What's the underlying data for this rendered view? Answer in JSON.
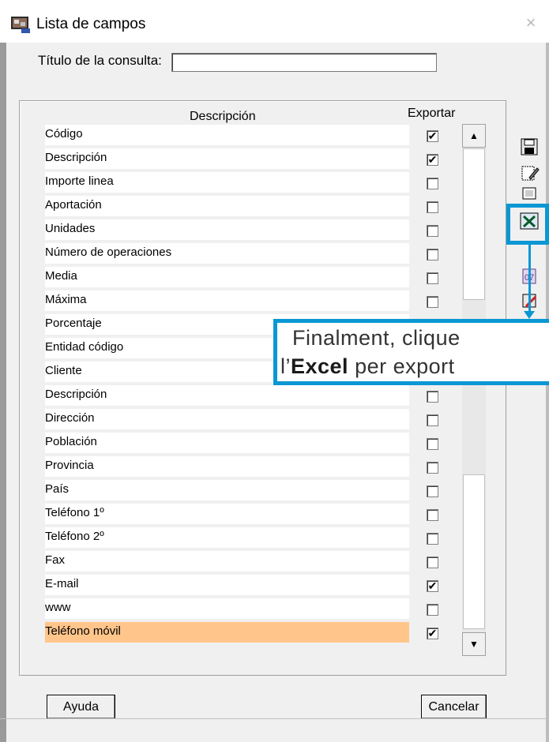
{
  "window": {
    "title": "Lista de campos",
    "close_glyph": "×",
    "accent_color": "#0a97d4",
    "selected_row_color": "#ffc58a"
  },
  "query": {
    "label": "Título de la consulta:",
    "value": ""
  },
  "table": {
    "col_description": "Descripción",
    "col_export": "Exportar",
    "rows": [
      {
        "label": "Código",
        "export": true
      },
      {
        "label": "Descripción",
        "export": true
      },
      {
        "label": "Importe linea",
        "export": false
      },
      {
        "label": "Aportación",
        "export": false
      },
      {
        "label": "Unidades",
        "export": false
      },
      {
        "label": "Número de operaciones",
        "export": false
      },
      {
        "label": "Media",
        "export": false
      },
      {
        "label": "Máxima",
        "export": false
      },
      {
        "label": "Porcentaje",
        "export": false
      },
      {
        "label": "Entidad código",
        "export": false
      },
      {
        "label": "Cliente",
        "export": false
      },
      {
        "label": "Descripción",
        "export": false
      },
      {
        "label": "Dirección",
        "export": false
      },
      {
        "label": "Población",
        "export": false
      },
      {
        "label": "Provincia",
        "export": false
      },
      {
        "label": "País",
        "export": false
      },
      {
        "label": "Teléfono 1º",
        "export": false
      },
      {
        "label": "Teléfono 2º",
        "export": false
      },
      {
        "label": "Fax",
        "export": false
      },
      {
        "label": "E-mail",
        "export": true
      },
      {
        "label": "www",
        "export": false
      },
      {
        "label": "Teléfono móvil",
        "export": true,
        "selected": true
      }
    ]
  },
  "toolbar": {
    "icons": [
      "save-icon",
      "edit-icon",
      "report-icon",
      "excel-icon",
      "document-icon",
      "query-icon",
      "delete-icon"
    ]
  },
  "callout": {
    "line1": "Finalment, clique",
    "line2_prefix": "l’",
    "line2_bold": "Excel",
    "line2_suffix": " per export"
  },
  "buttons": {
    "help": "Ayuda",
    "cancel": "Cancelar"
  }
}
